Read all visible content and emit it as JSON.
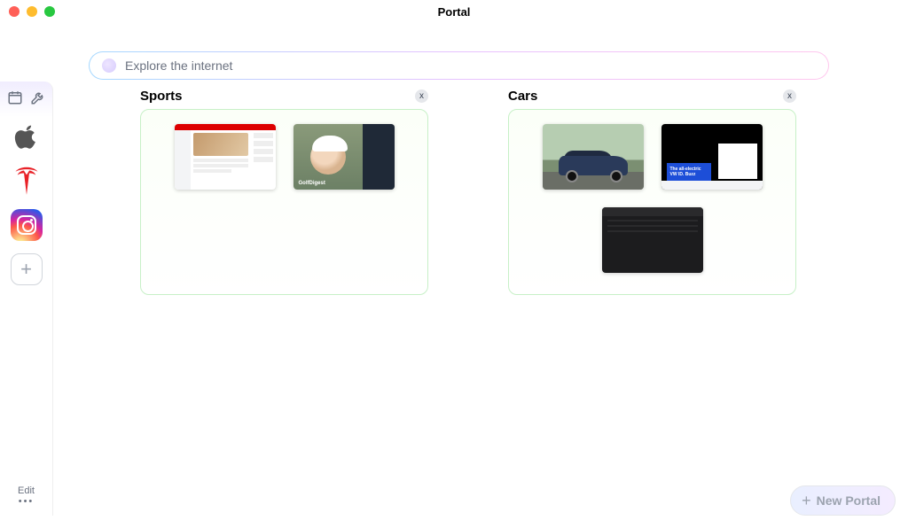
{
  "window": {
    "title": "Portal"
  },
  "traffic": {
    "close": "#ff5f57",
    "min": "#febc2e",
    "max": "#28c840"
  },
  "search": {
    "placeholder": "Explore the internet",
    "value": ""
  },
  "sidebar": {
    "tools": [
      "calendar-icon",
      "wrench-icon"
    ],
    "apps": [
      {
        "id": "apple",
        "name": "Apple"
      },
      {
        "id": "tesla",
        "name": "Tesla"
      },
      {
        "id": "instagram",
        "name": "Instagram"
      }
    ],
    "add_label": "+",
    "edit_label": "Edit"
  },
  "groups": [
    {
      "title": "Sports",
      "close": "x",
      "tabs": [
        {
          "id": "espn",
          "name": "ESPN homepage"
        },
        {
          "id": "golf",
          "name": "Golf Digest article",
          "overlay": "GolfDigest"
        }
      ]
    },
    {
      "title": "Cars",
      "close": "x",
      "tabs": [
        {
          "id": "car-photo",
          "name": "Blue sedan photo"
        },
        {
          "id": "vw",
          "name": "VW ID. Buzz page",
          "caption_line1": "The all-electric",
          "caption_line2": "VW ID. Buzz"
        },
        {
          "id": "dark-app",
          "name": "Dark app window"
        }
      ]
    }
  ],
  "new_portal": {
    "label": "New Portal",
    "plus": "+"
  }
}
